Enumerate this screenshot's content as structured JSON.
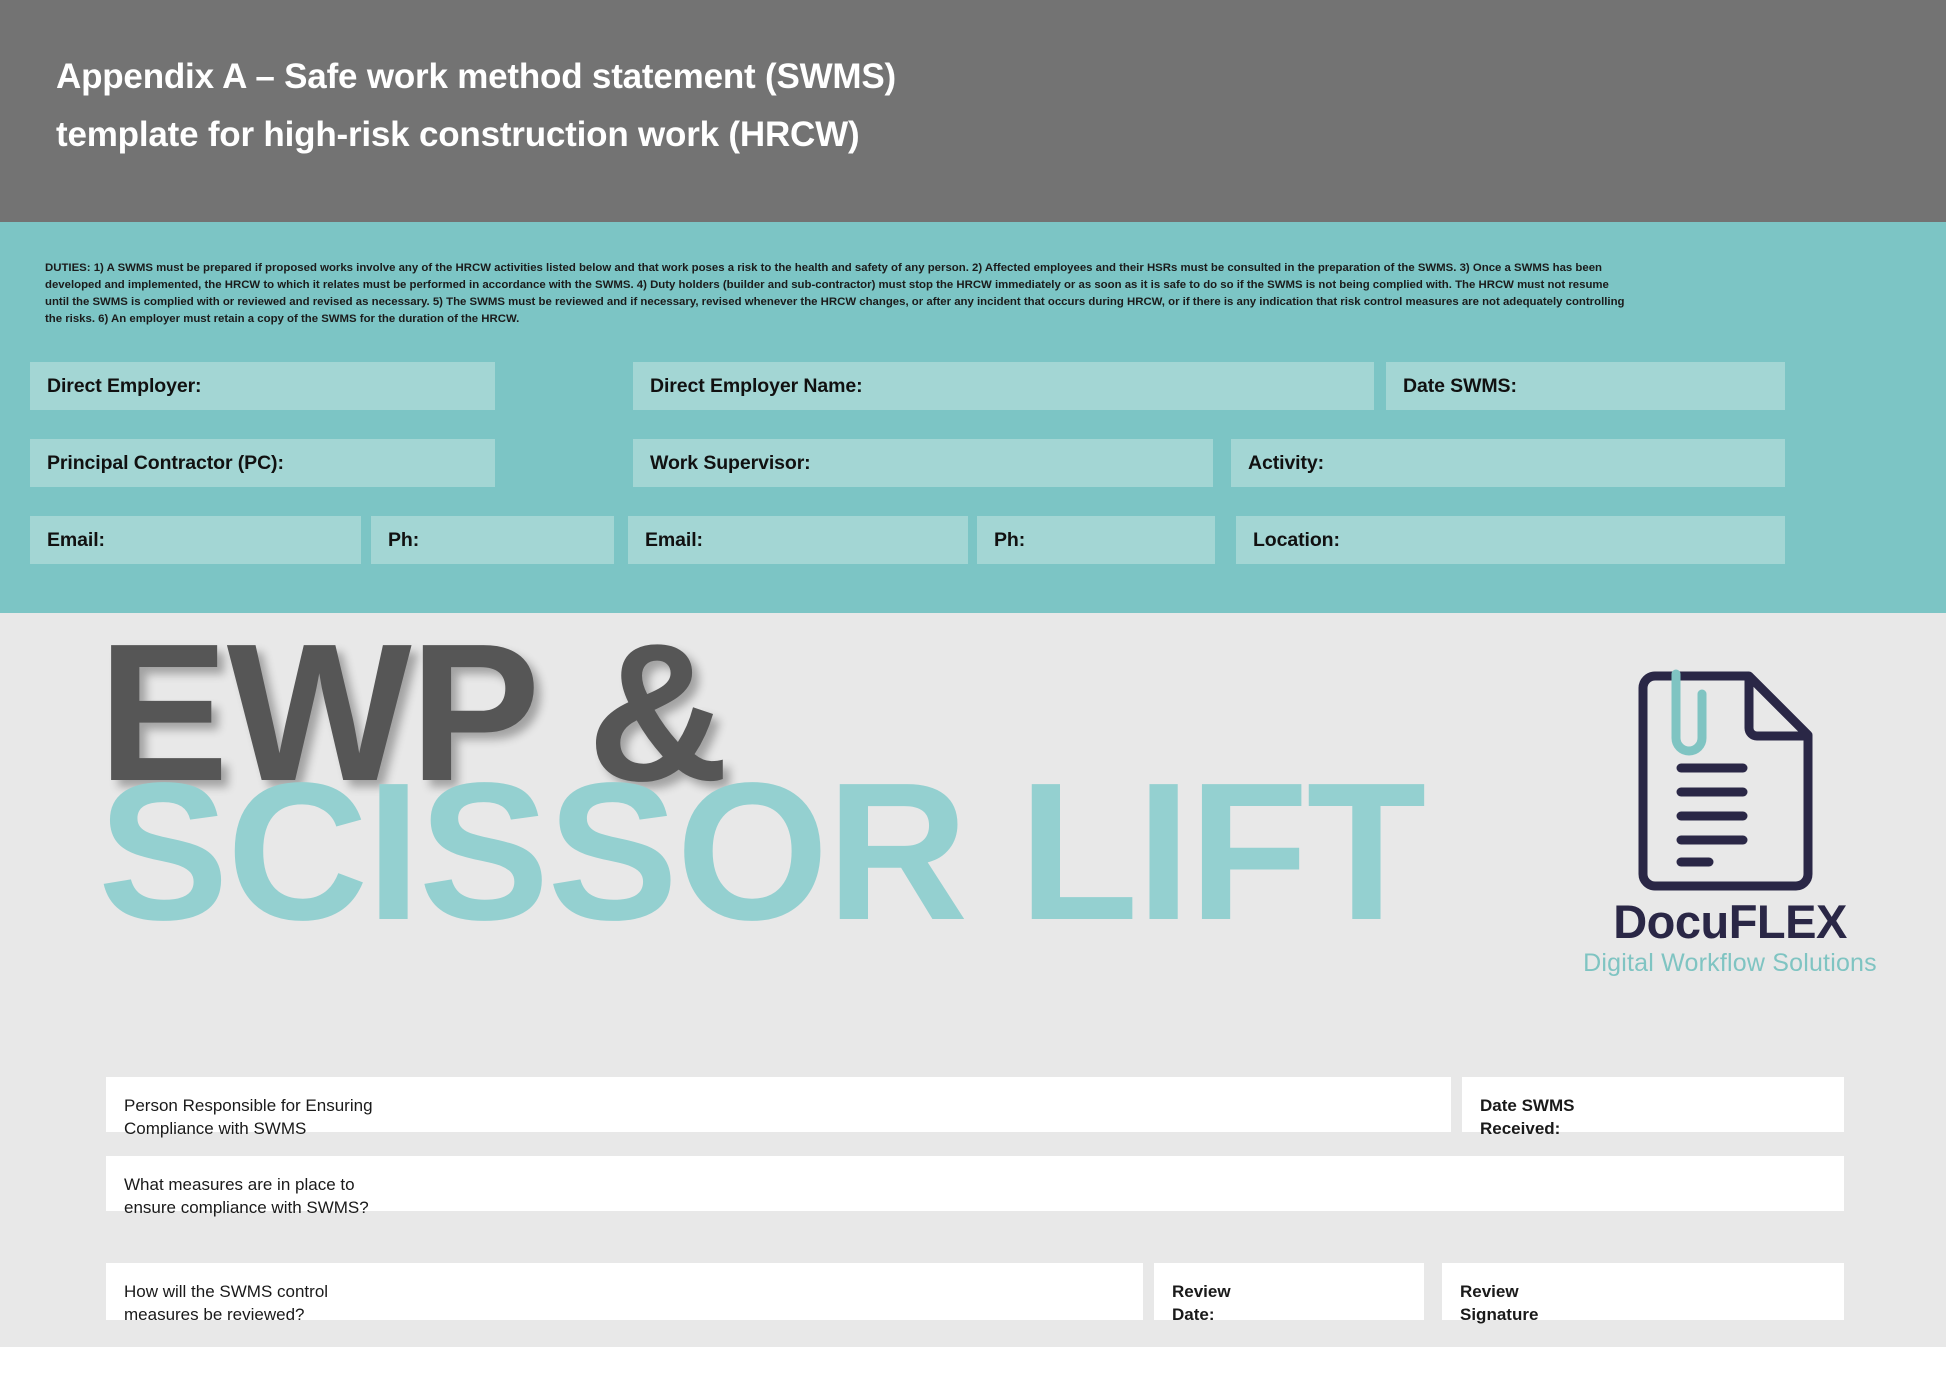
{
  "header": {
    "title_line1": "Appendix A – Safe work method statement (SWMS)",
    "title_line2": "template for high-risk construction work (HRCW)",
    "background_color": "#737373"
  },
  "duties": {
    "text": "DUTIES: 1) A SWMS must be prepared if proposed works involve any of the HRCW activities listed below and that work poses a risk to the health and safety of any person. 2) Affected employees and their HSRs must be consulted in the preparation of the SWMS. 3) Once a SWMS has been developed and implemented, the HRCW to which it relates must be performed in accordance with the SWMS. 4) Duty holders (builder and sub-contractor) must stop the HRCW immediately or as soon as it is safe to do so if the SWMS is not being complied with. The HRCW must not resume until the SWMS is complied with or reviewed and revised as necessary. 5) The SWMS must be reviewed and if necessary, revised whenever the HRCW changes, or after any incident that occurs during HRCW, or if there is any indication that risk control measures are not adequately controlling the risks. 6) An employer must retain a copy of the SWMS for the duration of the HRCW."
  },
  "teal_band": {
    "background_color": "#7CC5C5",
    "field_color": "#A3D6D4",
    "row1": [
      {
        "label": "Direct Employer:",
        "value": ""
      },
      {
        "label": "Direct Employer Name:",
        "value": ""
      },
      {
        "label": "Date SWMS:",
        "value": ""
      }
    ],
    "row2": [
      {
        "label": "Principal Contractor (PC):",
        "value": ""
      },
      {
        "label": "Work Supervisor:",
        "value": ""
      },
      {
        "label": "Activity:",
        "value": ""
      }
    ],
    "row3": [
      {
        "label": "Email:",
        "value": ""
      },
      {
        "label": "Ph:",
        "value": ""
      },
      {
        "label": "Email:",
        "value": ""
      },
      {
        "label": "Ph:",
        "value": ""
      },
      {
        "label": "Location:",
        "value": ""
      }
    ]
  },
  "hero": {
    "background_color": "#E8E8E8",
    "line1": "EWP &",
    "line1_color": "#565656",
    "line2": "SCISSOR LIFT",
    "line2_color": "#94D0D0"
  },
  "logo": {
    "name": "DocuFLEX",
    "tagline": "Digital Workflow Solutions",
    "mark_color": "#2A2746",
    "clip_color": "#7FC4C2",
    "name_color": "#2A2746",
    "tagline_color": "#7FC4C2"
  },
  "bottom_form": {
    "person_responsible": "Person Responsible for Ensuring\nCompliance with SWMS",
    "date_swms_received": "Date SWMS\nReceived:",
    "measures_question": "What measures are in place to\nensure compliance with SWMS?",
    "review_question": "How will the SWMS control\nmeasures be reviewed?",
    "review_date": "Review\nDate:",
    "review_signature": "Review\nSignature"
  }
}
